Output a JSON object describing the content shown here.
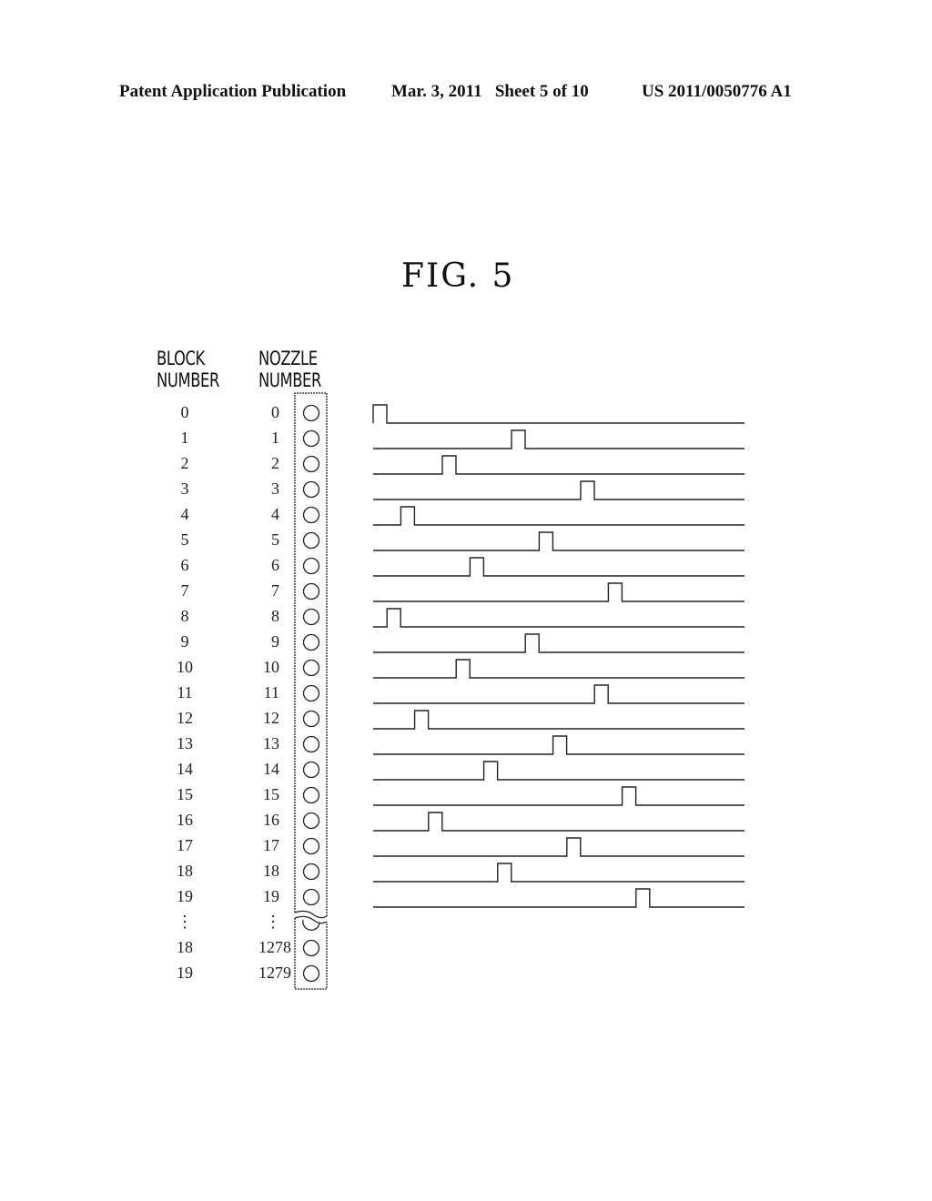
{
  "header": {
    "left": "Patent Application Publication",
    "middle": "Mar. 3, 2011   Sheet 5 of 10",
    "right": "US 2011/0050776 A1"
  },
  "figure": {
    "title": "FIG. 5",
    "block_header_line1": "BLOCK",
    "block_header_line2": "NUMBER",
    "nozzle_header_line1": "NOZZLE",
    "nozzle_header_line2": "NUMBER",
    "rows": [
      {
        "block": "0",
        "nozzle": "0",
        "slot": 0
      },
      {
        "block": "1",
        "nozzle": "1",
        "slot": 10
      },
      {
        "block": "2",
        "nozzle": "2",
        "slot": 5
      },
      {
        "block": "3",
        "nozzle": "3",
        "slot": 15
      },
      {
        "block": "4",
        "nozzle": "4",
        "slot": 2
      },
      {
        "block": "5",
        "nozzle": "5",
        "slot": 12
      },
      {
        "block": "6",
        "nozzle": "6",
        "slot": 7
      },
      {
        "block": "7",
        "nozzle": "7",
        "slot": 17
      },
      {
        "block": "8",
        "nozzle": "8",
        "slot": 1
      },
      {
        "block": "9",
        "nozzle": "9",
        "slot": 11
      },
      {
        "block": "10",
        "nozzle": "10",
        "slot": 6
      },
      {
        "block": "11",
        "nozzle": "11",
        "slot": 16
      },
      {
        "block": "12",
        "nozzle": "12",
        "slot": 3
      },
      {
        "block": "13",
        "nozzle": "13",
        "slot": 13
      },
      {
        "block": "14",
        "nozzle": "14",
        "slot": 8
      },
      {
        "block": "15",
        "nozzle": "15",
        "slot": 18
      },
      {
        "block": "16",
        "nozzle": "16",
        "slot": 4
      },
      {
        "block": "17",
        "nozzle": "17",
        "slot": 14
      },
      {
        "block": "18",
        "nozzle": "18",
        "slot": 9
      },
      {
        "block": "19",
        "nozzle": "19",
        "slot": 19
      }
    ],
    "ellipsis": "⋮",
    "tail_rows": [
      {
        "block": "18",
        "nozzle": "1278"
      },
      {
        "block": "19",
        "nozzle": "1279"
      }
    ],
    "slot_count": 20
  }
}
